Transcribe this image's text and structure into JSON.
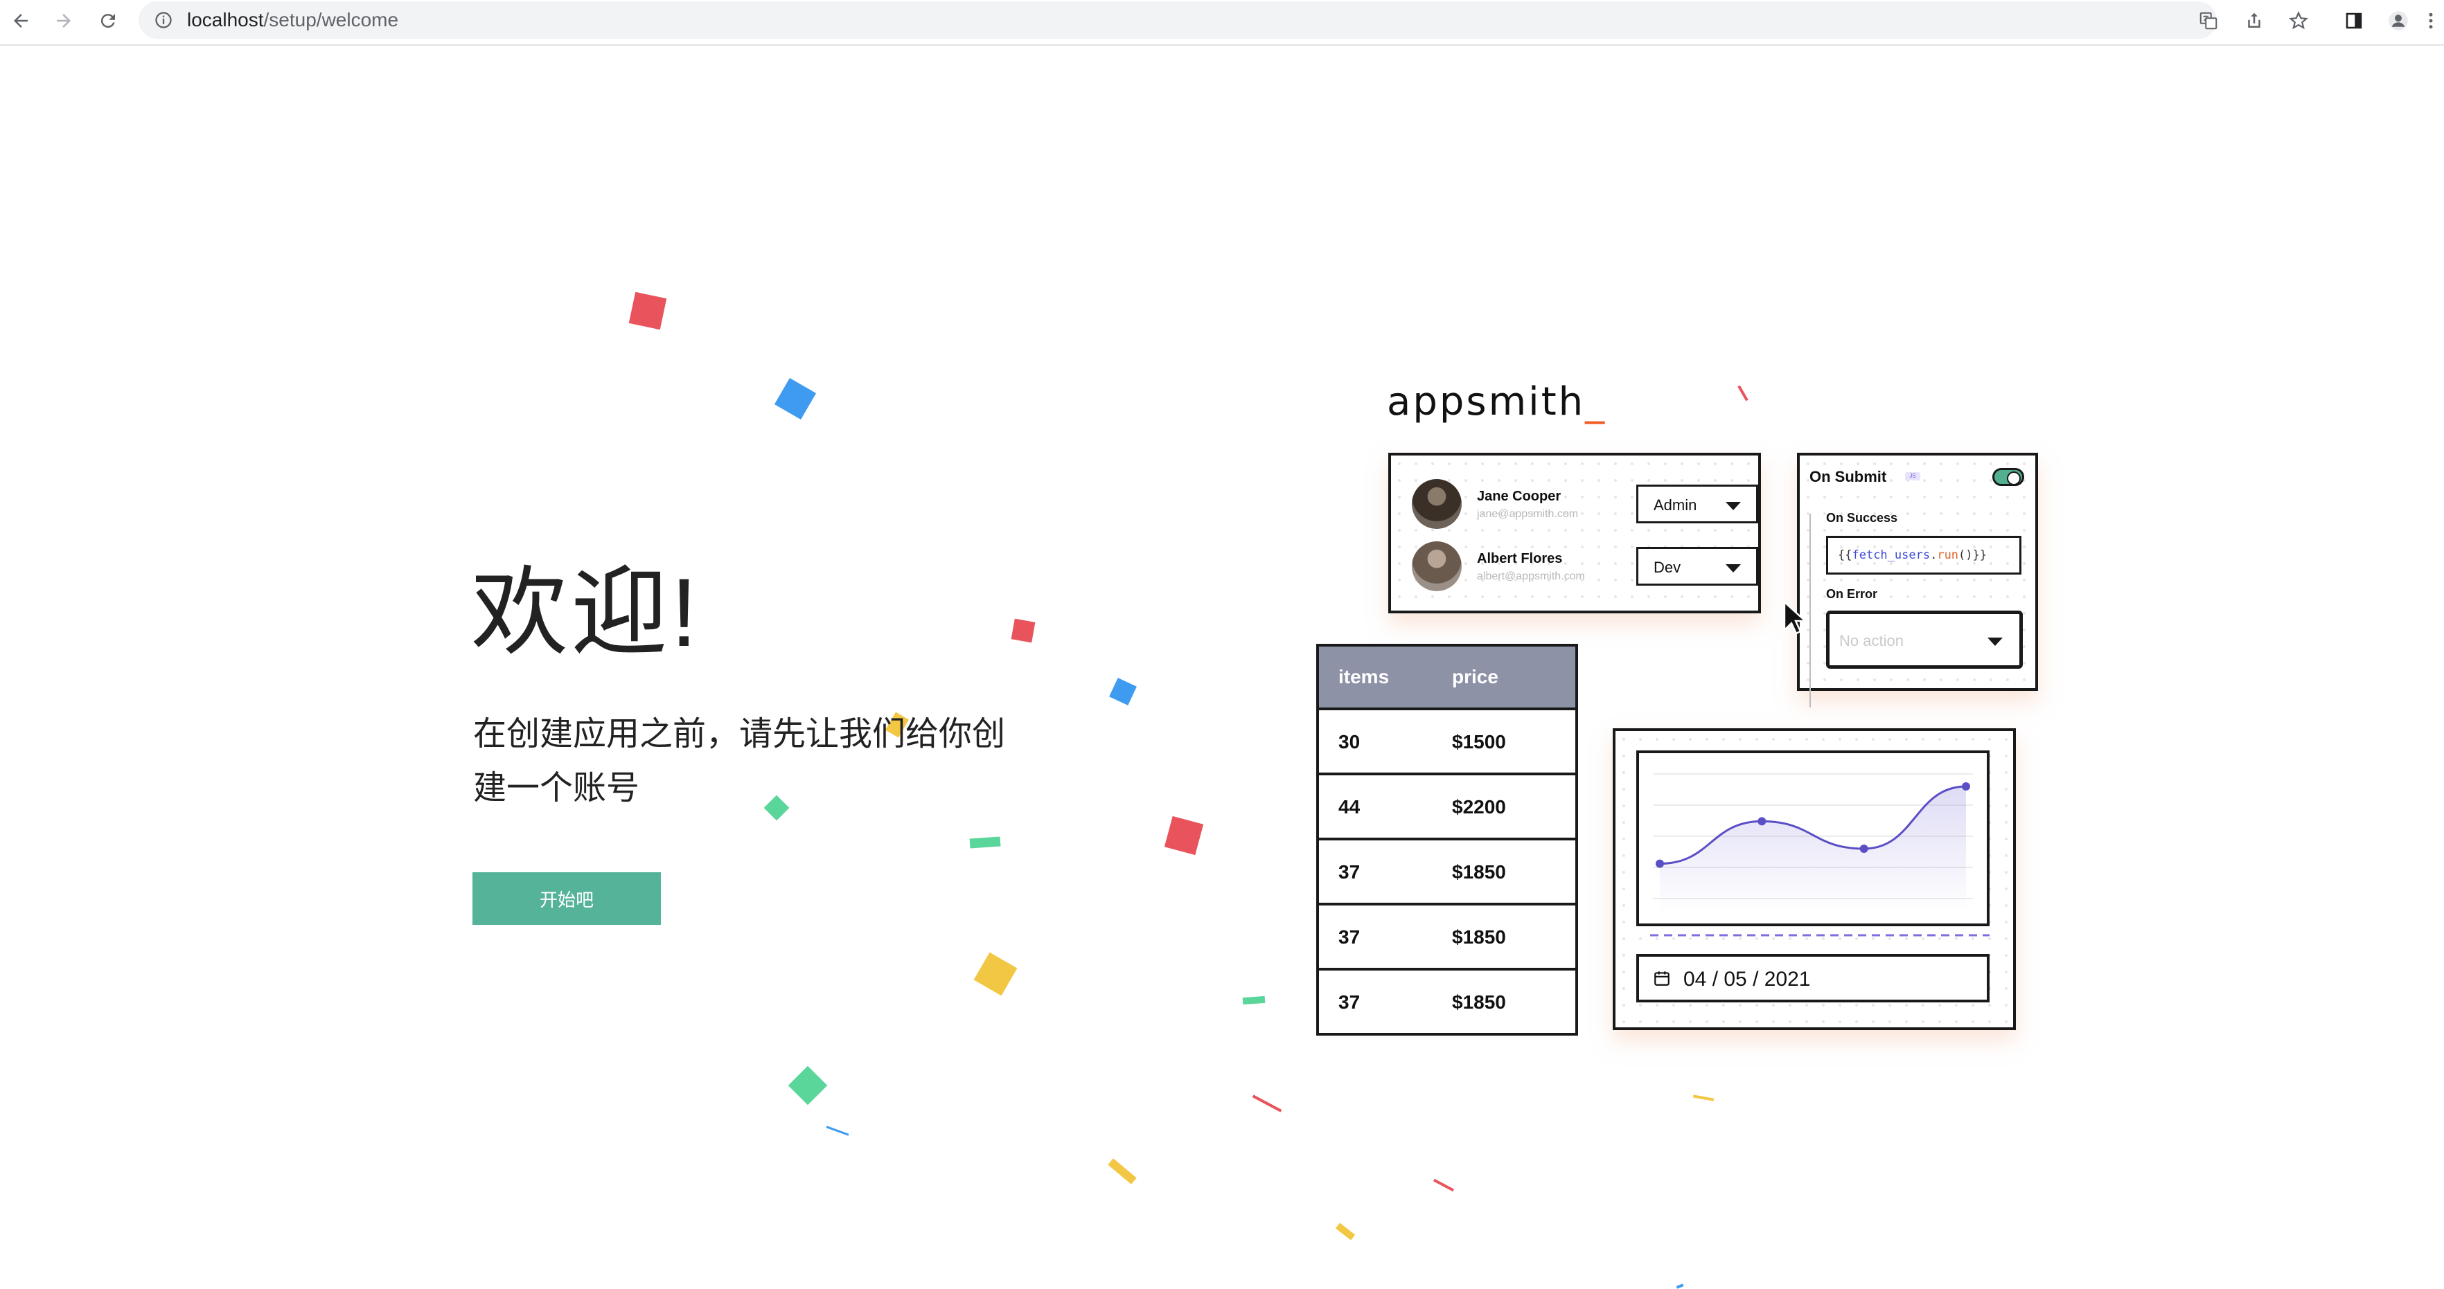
{
  "browser": {
    "url_host": "localhost",
    "url_path": "/setup/welcome"
  },
  "hero": {
    "title": "欢迎!",
    "subtitle": "在创建应用之前，请先让我们给你创建一个账号",
    "start_button": "开始吧"
  },
  "illustration": {
    "logo_text": "appsmith",
    "logo_suffix": "_",
    "users": [
      {
        "name": "Jane Cooper",
        "email": "jane@appsmith.com",
        "role": "Admin"
      },
      {
        "name": "Albert Flores",
        "email": "albert@appsmith.com",
        "role": "Dev"
      }
    ],
    "on_submit": {
      "title": "On Submit",
      "badge": "JS",
      "on_success_label": "On Success",
      "code_prefix": "{{",
      "code_fn": "fetch_users",
      "code_dot": ".",
      "code_run": "run",
      "code_suffix": "()}}",
      "on_error_label": "On Error",
      "on_error_placeholder": "No action"
    },
    "table": {
      "headers": [
        "items",
        "price"
      ],
      "rows": [
        [
          "30",
          "$1500"
        ],
        [
          "44",
          "$2200"
        ],
        [
          "37",
          "$1850"
        ],
        [
          "37",
          "$1850"
        ],
        [
          "37",
          "$1850"
        ]
      ]
    },
    "date_value": "04 / 05 / 2021",
    "chart_data": {
      "type": "line",
      "values": [
        1.4,
        3.1,
        2.0,
        4.5
      ],
      "curve": "smooth"
    }
  },
  "colors": {
    "accent": "#54b399",
    "brand_cursor": "#f05a22",
    "table_header": "#8d92a7",
    "chart_line": "#5b4fc6"
  }
}
